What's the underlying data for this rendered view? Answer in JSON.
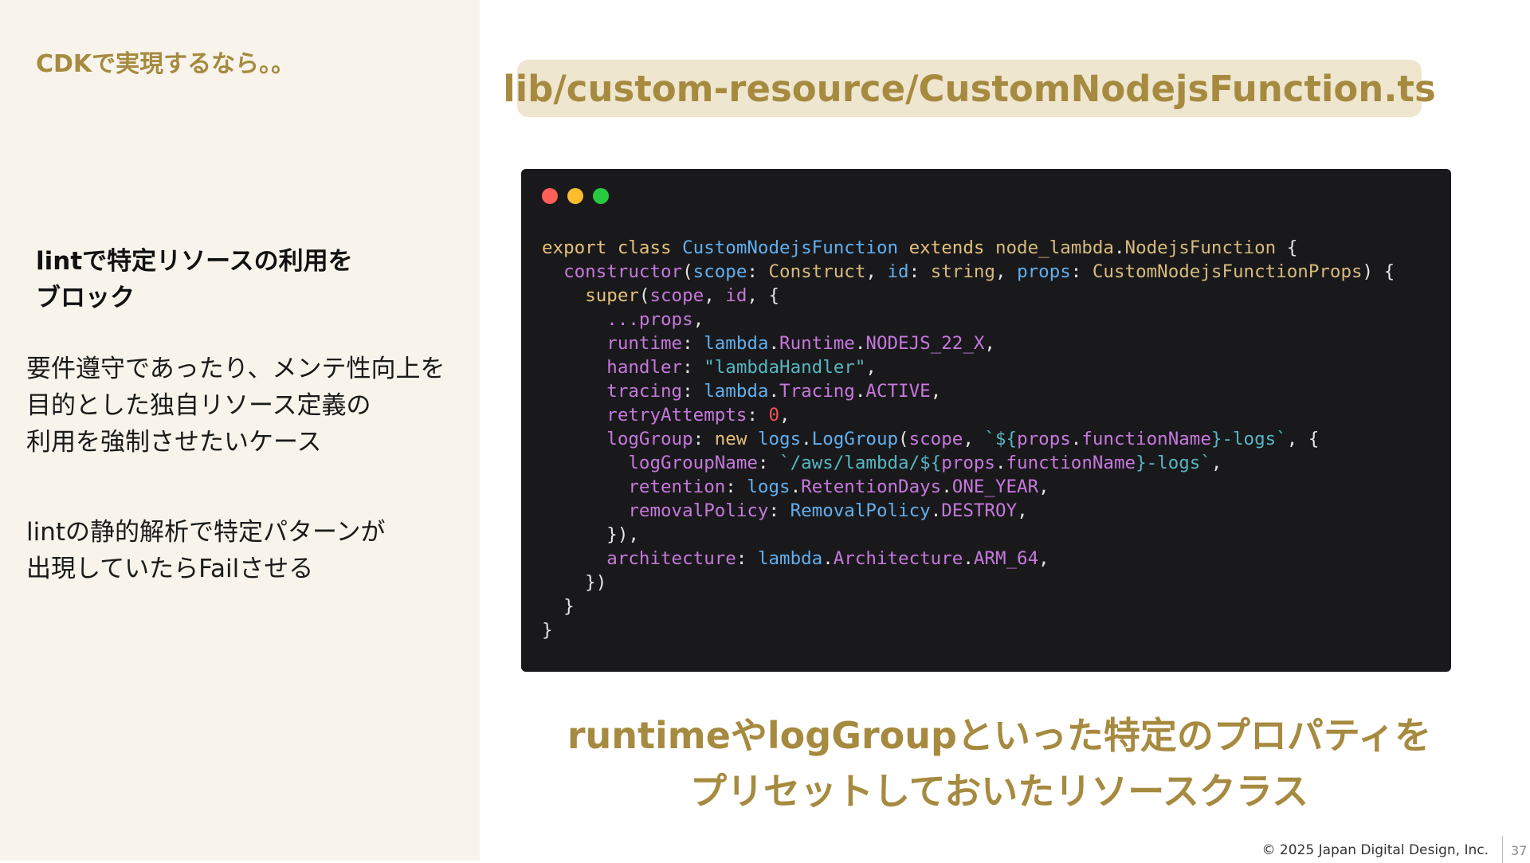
{
  "slide": {
    "section_label": "CDKで実現するなら。。",
    "subheading_lines": [
      "lintで特定リソースの利用を",
      "ブロック"
    ],
    "description_1_lines": [
      "要件遵守であったり、メンテ性向上を",
      "目的とした独自リソース定義の",
      "利用を強制させたいケース"
    ],
    "description_2_lines": [
      "lintの静的解析で特定パターンが",
      "出現していたらFailさせる"
    ],
    "file_path": "lib/custom-resource/CustomNodejsFunction.ts",
    "caption_lines": [
      "runtimeやlogGroupといった特定のプロパティを",
      "プリセットしておいたリソースクラス"
    ],
    "footer": {
      "copyright": "© 2025 Japan Digital Design, Inc.",
      "page_number": "37"
    }
  },
  "code_window": {
    "traffic_lights": [
      "red",
      "yellow",
      "green"
    ],
    "lines": [
      [
        [
          "kw",
          "export class "
        ],
        [
          "cls",
          "CustomNodejsFunction "
        ],
        [
          "kw",
          "extends "
        ],
        [
          "type",
          "node_lambda"
        ],
        [
          "plain",
          "."
        ],
        [
          "type",
          "NodejsFunction"
        ],
        [
          "plain",
          " {"
        ]
      ],
      [
        [
          "plain",
          "  "
        ],
        [
          "var",
          "constructor"
        ],
        [
          "plain",
          "("
        ],
        [
          "cls",
          "scope"
        ],
        [
          "plain",
          ": "
        ],
        [
          "type",
          "Construct"
        ],
        [
          "plain",
          ", "
        ],
        [
          "cls",
          "id"
        ],
        [
          "plain",
          ": "
        ],
        [
          "type",
          "string"
        ],
        [
          "plain",
          ", "
        ],
        [
          "cls",
          "props"
        ],
        [
          "plain",
          ": "
        ],
        [
          "type",
          "CustomNodejsFunctionProps"
        ],
        [
          "plain",
          ") {"
        ]
      ],
      [
        [
          "plain",
          "    "
        ],
        [
          "kw",
          "super"
        ],
        [
          "plain",
          "("
        ],
        [
          "var",
          "scope"
        ],
        [
          "plain",
          ", "
        ],
        [
          "var",
          "id"
        ],
        [
          "plain",
          ", {"
        ]
      ],
      [
        [
          "plain",
          "      "
        ],
        [
          "prop",
          "...props"
        ],
        [
          "plain",
          ","
        ]
      ],
      [
        [
          "plain",
          "      "
        ],
        [
          "prop",
          "runtime"
        ],
        [
          "plain",
          ": "
        ],
        [
          "cls",
          "lambda"
        ],
        [
          "plain",
          "."
        ],
        [
          "prop",
          "Runtime"
        ],
        [
          "plain",
          "."
        ],
        [
          "prop",
          "NODEJS_22_X"
        ],
        [
          "plain",
          ","
        ]
      ],
      [
        [
          "plain",
          "      "
        ],
        [
          "prop",
          "handler"
        ],
        [
          "plain",
          ": "
        ],
        [
          "str",
          "\"lambdaHandler\""
        ],
        [
          "plain",
          ","
        ]
      ],
      [
        [
          "plain",
          "      "
        ],
        [
          "prop",
          "tracing"
        ],
        [
          "plain",
          ": "
        ],
        [
          "cls",
          "lambda"
        ],
        [
          "plain",
          "."
        ],
        [
          "prop",
          "Tracing"
        ],
        [
          "plain",
          "."
        ],
        [
          "prop",
          "ACTIVE"
        ],
        [
          "plain",
          ","
        ]
      ],
      [
        [
          "plain",
          "      "
        ],
        [
          "prop",
          "retryAttempts"
        ],
        [
          "plain",
          ": "
        ],
        [
          "num",
          "0"
        ],
        [
          "plain",
          ","
        ]
      ],
      [
        [
          "plain",
          "      "
        ],
        [
          "prop",
          "logGroup"
        ],
        [
          "plain",
          ": "
        ],
        [
          "kw",
          "new "
        ],
        [
          "cls",
          "logs"
        ],
        [
          "plain",
          "."
        ],
        [
          "cls",
          "LogGroup"
        ],
        [
          "plain",
          "("
        ],
        [
          "var",
          "scope"
        ],
        [
          "plain",
          ", "
        ],
        [
          "str",
          "`${"
        ],
        [
          "var",
          "props"
        ],
        [
          "plain",
          "."
        ],
        [
          "var",
          "functionName"
        ],
        [
          "str",
          "}-logs`"
        ],
        [
          "plain",
          ", {"
        ]
      ],
      [
        [
          "plain",
          "        "
        ],
        [
          "prop",
          "logGroupName"
        ],
        [
          "plain",
          ": "
        ],
        [
          "str",
          "`/aws/lambda/${"
        ],
        [
          "var",
          "props"
        ],
        [
          "plain",
          "."
        ],
        [
          "var",
          "functionName"
        ],
        [
          "str",
          "}-logs`"
        ],
        [
          "plain",
          ","
        ]
      ],
      [
        [
          "plain",
          "        "
        ],
        [
          "prop",
          "retention"
        ],
        [
          "plain",
          ": "
        ],
        [
          "cls",
          "logs"
        ],
        [
          "plain",
          "."
        ],
        [
          "prop",
          "RetentionDays"
        ],
        [
          "plain",
          "."
        ],
        [
          "prop",
          "ONE_YEAR"
        ],
        [
          "plain",
          ","
        ]
      ],
      [
        [
          "plain",
          "        "
        ],
        [
          "prop",
          "removalPolicy"
        ],
        [
          "plain",
          ": "
        ],
        [
          "cls",
          "RemovalPolicy"
        ],
        [
          "plain",
          "."
        ],
        [
          "prop",
          "DESTROY"
        ],
        [
          "plain",
          ","
        ]
      ],
      [
        [
          "plain",
          "      }),"
        ]
      ],
      [
        [
          "plain",
          "      "
        ],
        [
          "prop",
          "architecture"
        ],
        [
          "plain",
          ": "
        ],
        [
          "cls",
          "lambda"
        ],
        [
          "plain",
          "."
        ],
        [
          "prop",
          "Architecture"
        ],
        [
          "plain",
          "."
        ],
        [
          "prop",
          "ARM_64"
        ],
        [
          "plain",
          ","
        ]
      ],
      [
        [
          "plain",
          "    })"
        ]
      ],
      [
        [
          "plain",
          "  }"
        ]
      ],
      [
        [
          "plain",
          "}"
        ]
      ]
    ]
  },
  "colors": {
    "accent_gold": "#a68a3f",
    "left_panel_bg": "#f8f4ec",
    "file_pill_bg": "#eee6cf",
    "code_bg": "#19191b"
  }
}
